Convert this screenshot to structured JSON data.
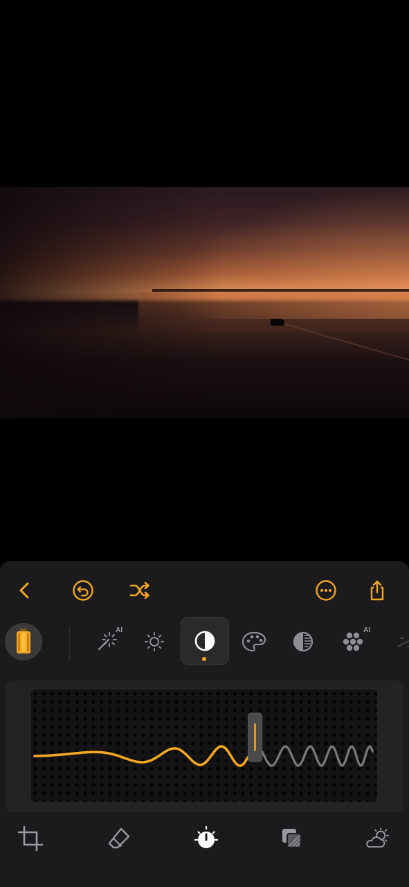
{
  "colors": {
    "accent": "#f5a623",
    "panel": "#1b1b1d",
    "icon_inactive": "#8e8e93",
    "slider_inactive": "#7a7a7e"
  },
  "photo": {
    "description_icon": "sunset-boat-photo"
  },
  "toolbar": {
    "back_icon": "chevron-left-icon",
    "undo_icon": "undo-icon",
    "shuffle_icon": "shuffle-icon",
    "more_icon": "more-icon",
    "share_icon": "share-icon"
  },
  "tools": {
    "film_icon": "film-roll-icon",
    "items": [
      {
        "icon": "magic-wand-icon",
        "badge": "AI"
      },
      {
        "icon": "brightness-icon",
        "badge": ""
      },
      {
        "icon": "contrast-icon",
        "badge": "",
        "selected": true
      },
      {
        "icon": "palette-icon",
        "badge": ""
      },
      {
        "icon": "tone-icon",
        "badge": ""
      },
      {
        "icon": "dots-cluster-icon",
        "badge": "AI"
      },
      {
        "icon": "more-tools-icon",
        "badge": ""
      }
    ]
  },
  "slider": {
    "value_fraction": 0.65
  },
  "bottom_nav": {
    "items": [
      {
        "icon": "crop-icon"
      },
      {
        "icon": "eraser-icon"
      },
      {
        "icon": "adjust-dial-icon",
        "selected": true
      },
      {
        "icon": "layers-icon"
      },
      {
        "icon": "weather-icon"
      }
    ]
  }
}
